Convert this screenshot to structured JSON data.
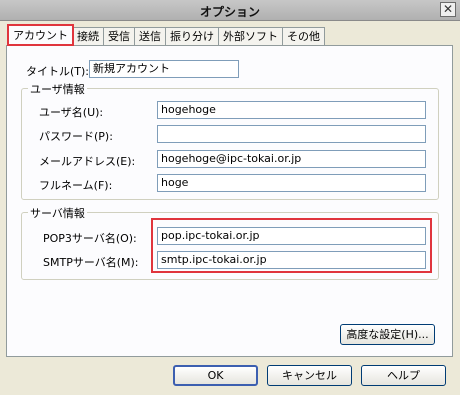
{
  "window": {
    "title": "オプション",
    "close_glyph": "✕"
  },
  "tabs": [
    {
      "label": "アカウント"
    },
    {
      "label": "接続"
    },
    {
      "label": "受信"
    },
    {
      "label": "送信"
    },
    {
      "label": "振り分け"
    },
    {
      "label": "外部ソフト"
    },
    {
      "label": "その他"
    }
  ],
  "account": {
    "title_label": "タイトル(T):",
    "title_value": "新規アカウント"
  },
  "user_info": {
    "group_label": "ユーザ情報",
    "username_label": "ユーザ名(U):",
    "username_value": "hogehoge",
    "password_label": "パスワード(P):",
    "password_value": "",
    "email_label": "メールアドレス(E):",
    "email_value": "hogehoge@ipc-tokai.or.jp",
    "fullname_label": "フルネーム(F):",
    "fullname_value": "hoge"
  },
  "server_info": {
    "group_label": "サーバ情報",
    "pop3_label": "POP3サーバ名(O):",
    "pop3_value": "pop.ipc-tokai.or.jp",
    "smtp_label": "SMTPサーバ名(M):",
    "smtp_value": "smtp.ipc-tokai.or.jp"
  },
  "buttons": {
    "advanced": "高度な設定(H)...",
    "ok": "OK",
    "cancel": "キャンセル",
    "help": "ヘルプ"
  }
}
